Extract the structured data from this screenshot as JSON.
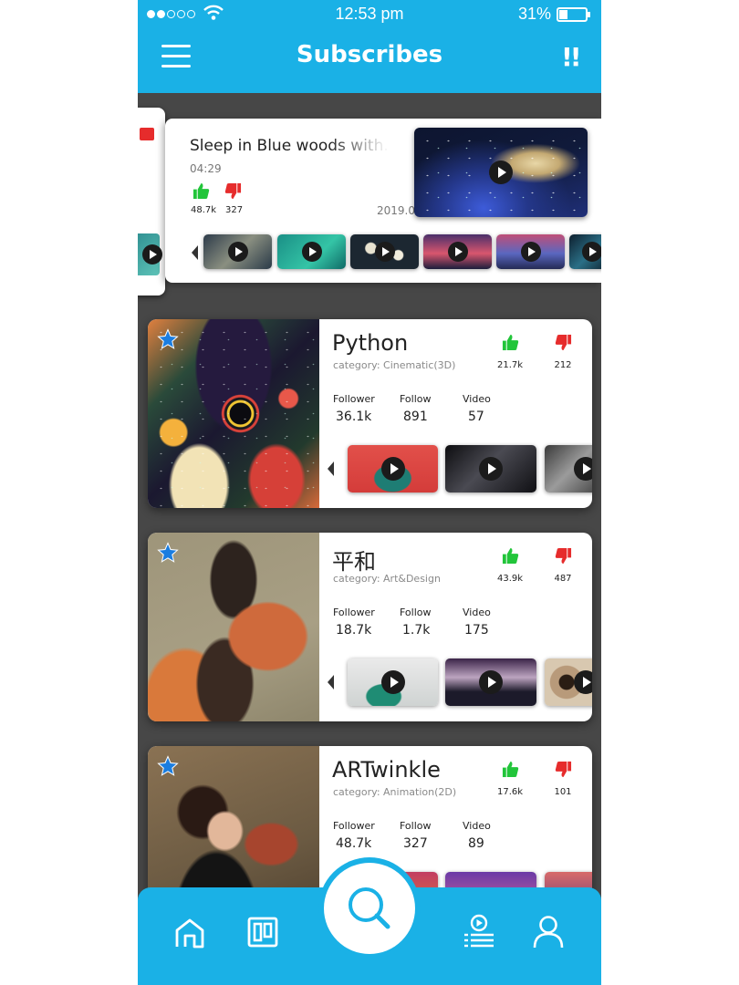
{
  "status": {
    "time": "12:53 pm",
    "battery": "31%",
    "battery_level": 0.31
  },
  "header": {
    "title": "Subscribes",
    "alert_label": "!!"
  },
  "featured": {
    "title": "Sleep in Blue woods with...",
    "duration": "04:29",
    "likes": "48.7k",
    "dislikes": "327",
    "date": "2019.05.29"
  },
  "channels": [
    {
      "name": "Python",
      "category": "category: Cinematic(3D)",
      "likes": "21.7k",
      "dislikes": "212",
      "stats": {
        "follower_label": "Follower",
        "follower": "36.1k",
        "follow_label": "Follow",
        "follow": "891",
        "video_label": "Video",
        "video": "57"
      }
    },
    {
      "name": "平和",
      "category": "category: Art&Design",
      "likes": "43.9k",
      "dislikes": "487",
      "stats": {
        "follower_label": "Follower",
        "follower": "18.7k",
        "follow_label": "Follow",
        "follow": "1.7k",
        "video_label": "Video",
        "video": "175"
      }
    },
    {
      "name": "ARTwinkle",
      "category": "category: Animation(2D)",
      "likes": "17.6k",
      "dislikes": "101",
      "stats": {
        "follower_label": "Follower",
        "follower": "48.7k",
        "follow_label": "Follow",
        "follow": "327",
        "video_label": "Video",
        "video": "89"
      }
    }
  ],
  "nav": {
    "items": [
      "home-icon",
      "board-icon",
      "search-icon",
      "playlist-icon",
      "user-icon"
    ]
  },
  "colors": {
    "accent": "#1ab1e6",
    "like": "#22c53a",
    "dislike": "#e62c2c",
    "star": "#1a7de0",
    "background": "#474747"
  }
}
